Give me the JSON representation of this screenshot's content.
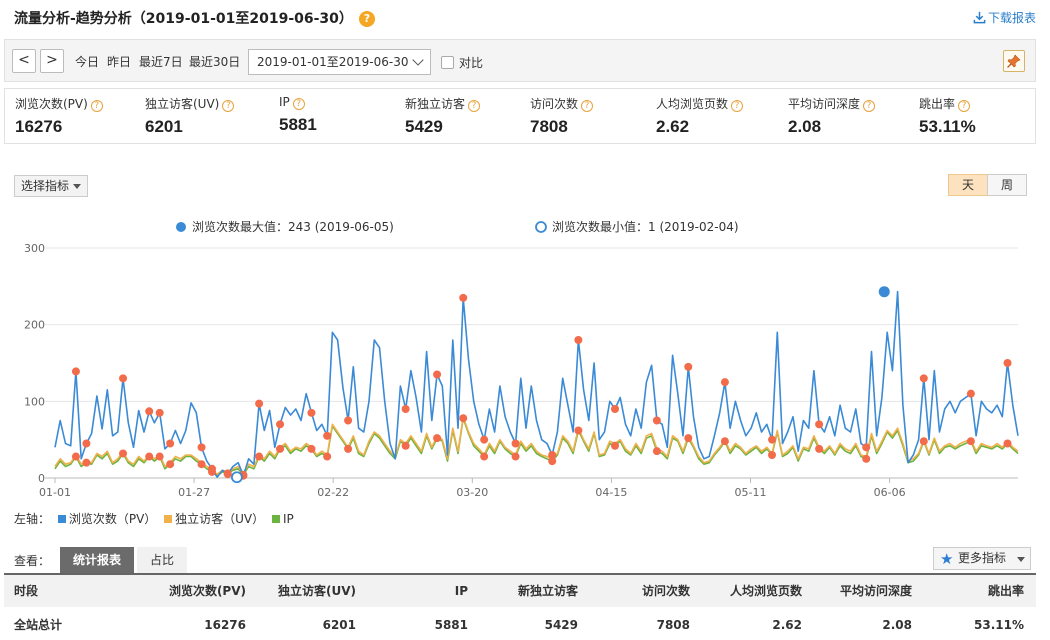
{
  "header": {
    "title": "流量分析-趋势分析（2019-01-01至2019-06-30）",
    "help": "?",
    "download": "下载报表"
  },
  "toolbar": {
    "prev": "<",
    "next": ">",
    "quick": [
      "今日",
      "昨日",
      "最近7日",
      "最近30日"
    ],
    "date_range": "2019-01-01至2019-06-30",
    "compare": "对比"
  },
  "metrics": [
    {
      "label": "浏览次数(PV)",
      "value": "16276"
    },
    {
      "label": "独立访客(UV)",
      "value": "6201"
    },
    {
      "label": "IP",
      "value": "5881"
    },
    {
      "label": "新独立访客",
      "value": "5429"
    },
    {
      "label": "访问次数",
      "value": "7808"
    },
    {
      "label": "人均浏览页数",
      "value": "2.62"
    },
    {
      "label": "平均访问深度",
      "value": "2.08"
    },
    {
      "label": "跳出率",
      "value": "53.11%"
    }
  ],
  "controls": {
    "select_metric": "选择指标",
    "day": "天",
    "week": "周"
  },
  "chart_data": {
    "type": "line",
    "annotations": {
      "max_label": "浏览次数最大值：243 (2019-06-05)",
      "min_label": "浏览次数最小值：1 (2019-02-04)",
      "max": {
        "x": "2019-06-05",
        "y": 243
      },
      "min": {
        "x": "2019-02-04",
        "y": 1
      }
    },
    "y_ticks": [
      "300",
      "200",
      "100",
      "0"
    ],
    "ylim": [
      0,
      300
    ],
    "x_ticks": [
      "01-01",
      "01-27",
      "02-22",
      "03-20",
      "04-15",
      "05-11",
      "06-06"
    ],
    "x_start": "2019-01-01",
    "x_end": "2019-06-30",
    "grid": true,
    "legend_position": "bottom-left",
    "series": [
      {
        "name": "浏览次数（PV）",
        "color": "#3a8ad6",
        "values": [
          40,
          75,
          45,
          42,
          139,
          25,
          45,
          58,
          107,
          64,
          115,
          55,
          60,
          130,
          72,
          40,
          88,
          60,
          87,
          72,
          85,
          38,
          45,
          62,
          45,
          62,
          98,
          85,
          40,
          22,
          12,
          1,
          10,
          5,
          15,
          20,
          3,
          25,
          18,
          97,
          62,
          88,
          40,
          70,
          92,
          82,
          90,
          75,
          110,
          85,
          62,
          70,
          55,
          190,
          180,
          118,
          75,
          145,
          65,
          60,
          100,
          180,
          170,
          100,
          45,
          25,
          120,
          90,
          140,
          105,
          60,
          165,
          75,
          135,
          120,
          30,
          180,
          65,
          235,
          155,
          100,
          70,
          50,
          90,
          60,
          120,
          80,
          60,
          45,
          130,
          65,
          120,
          75,
          50,
          45,
          30,
          60,
          130,
          95,
          60,
          180,
          115,
          75,
          150,
          50,
          60,
          100,
          90,
          105,
          70,
          55,
          90,
          65,
          125,
          147,
          75,
          70,
          40,
          160,
          110,
          55,
          145,
          80,
          40,
          25,
          28,
          55,
          85,
          125,
          65,
          100,
          75,
          55,
          65,
          85,
          60,
          70,
          50,
          190,
          45,
          60,
          80,
          35,
          75,
          65,
          140,
          70,
          60,
          80,
          55,
          95,
          65,
          60,
          90,
          45,
          40,
          165,
          55,
          105,
          190,
          140,
          243,
          95,
          20,
          30,
          50,
          130,
          50,
          140,
          60,
          90,
          100,
          85,
          100,
          105,
          110,
          55,
          100,
          90,
          85,
          95,
          80,
          150,
          95,
          55
        ],
        "marked_points": [
          4,
          6,
          13,
          18,
          20,
          22,
          28,
          30,
          33,
          36,
          39,
          43,
          49,
          52,
          56,
          67,
          73,
          78,
          82,
          88,
          95,
          100,
          107,
          115,
          121,
          128,
          137,
          146,
          155,
          166,
          175,
          182
        ]
      },
      {
        "name": "独立访客（UV）",
        "color": "#f0b04a",
        "values": [
          15,
          25,
          18,
          20,
          30,
          18,
          22,
          20,
          32,
          28,
          35,
          20,
          25,
          35,
          22,
          18,
          28,
          22,
          30,
          25,
          30,
          15,
          20,
          28,
          25,
          30,
          30,
          25,
          20,
          15,
          10,
          5,
          10,
          8,
          12,
          15,
          6,
          18,
          15,
          30,
          25,
          35,
          28,
          40,
          45,
          35,
          40,
          38,
          45,
          40,
          30,
          35,
          30,
          70,
          60,
          50,
          40,
          55,
          35,
          30,
          48,
          60,
          55,
          45,
          35,
          28,
          50,
          45,
          55,
          45,
          35,
          58,
          40,
          55,
          50,
          25,
          65,
          35,
          80,
          60,
          45,
          38,
          30,
          45,
          35,
          50,
          40,
          35,
          30,
          48,
          38,
          45,
          35,
          30,
          28,
          25,
          32,
          55,
          48,
          35,
          65,
          50,
          38,
          60,
          30,
          32,
          48,
          45,
          50,
          38,
          32,
          45,
          35,
          55,
          58,
          38,
          35,
          28,
          55,
          50,
          35,
          55,
          42,
          28,
          20,
          22,
          32,
          40,
          50,
          35,
          45,
          40,
          32,
          38,
          42,
          35,
          40,
          32,
          62,
          30,
          35,
          42,
          25,
          40,
          38,
          55,
          40,
          35,
          42,
          32,
          45,
          38,
          35,
          45,
          30,
          28,
          58,
          35,
          48,
          62,
          55,
          65,
          45,
          22,
          25,
          32,
          50,
          32,
          52,
          35,
          42,
          45,
          40,
          45,
          48,
          50,
          35,
          45,
          42,
          40,
          45,
          40,
          48,
          40,
          35
        ]
      },
      {
        "name": "IP",
        "color": "#6cb33f",
        "values": [
          12,
          22,
          15,
          18,
          28,
          15,
          20,
          18,
          30,
          25,
          32,
          18,
          22,
          32,
          20,
          15,
          25,
          20,
          28,
          22,
          28,
          12,
          18,
          25,
          22,
          28,
          28,
          22,
          18,
          12,
          8,
          3,
          8,
          6,
          10,
          12,
          4,
          15,
          12,
          28,
          22,
          32,
          25,
          38,
          42,
          32,
          38,
          35,
          42,
          38,
          28,
          32,
          28,
          68,
          58,
          48,
          38,
          52,
          32,
          28,
          45,
          58,
          52,
          42,
          32,
          25,
          48,
          42,
          52,
          42,
          32,
          55,
          38,
          52,
          48,
          22,
          62,
          32,
          78,
          58,
          42,
          35,
          28,
          42,
          32,
          48,
          38,
          32,
          28,
          45,
          35,
          42,
          32,
          28,
          25,
          22,
          30,
          52,
          45,
          32,
          62,
          48,
          35,
          58,
          28,
          30,
          45,
          42,
          48,
          35,
          30,
          42,
          32,
          52,
          55,
          35,
          32,
          25,
          52,
          48,
          32,
          52,
          40,
          25,
          18,
          20,
          30,
          38,
          48,
          32,
          42,
          38,
          30,
          35,
          40,
          32,
          38,
          30,
          60,
          28,
          32,
          40,
          22,
          38,
          35,
          52,
          38,
          32,
          40,
          30,
          42,
          35,
          32,
          42,
          28,
          25,
          55,
          32,
          45,
          60,
          52,
          62,
          42,
          20,
          22,
          30,
          48,
          30,
          50,
          32,
          40,
          42,
          38,
          42,
          45,
          48,
          32,
          42,
          40,
          38,
          42,
          38,
          45,
          38,
          32
        ]
      }
    ]
  },
  "axis_legend": {
    "prefix": "左轴：",
    "items": [
      "浏览次数（PV）",
      "独立访客（UV）",
      "IP"
    ]
  },
  "view": {
    "label": "查看：",
    "tab_report": "统计报表",
    "tab_ratio": "占比",
    "more": "更多指标"
  },
  "table": {
    "headers": [
      "时段",
      "浏览次数(PV)",
      "独立访客(UV)",
      "IP",
      "新独立访客",
      "访问次数",
      "人均浏览页数",
      "平均访问深度",
      "跳出率"
    ],
    "total": [
      "全站总计",
      "16276",
      "6201",
      "5881",
      "5429",
      "7808",
      "2.62",
      "2.08",
      "53.11%"
    ]
  }
}
